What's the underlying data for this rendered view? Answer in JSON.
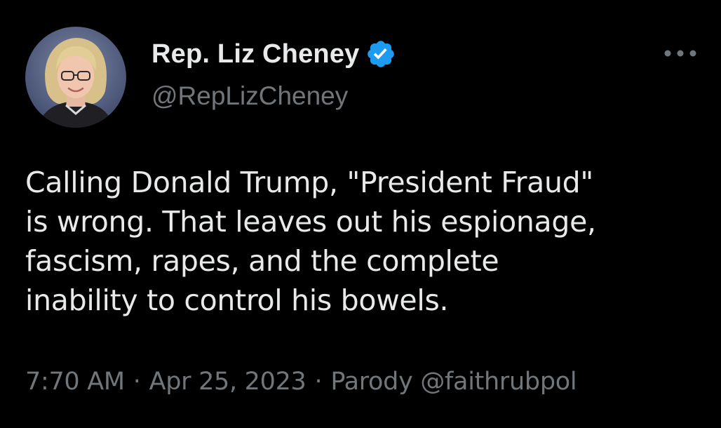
{
  "tweet": {
    "author": {
      "display_name": "Rep. Liz Cheney",
      "handle": "@RepLizCheney",
      "verified": true,
      "avatar_icon": "profile-photo"
    },
    "text_lines": [
      "Calling Donald Trump, \"President Fraud\"",
      "is wrong. That leaves out his espionage,",
      "fascism, rapes, and the complete",
      "inability to control his bowels."
    ],
    "meta": {
      "time": "7:70 AM",
      "separator": "·",
      "date": "Apr 25, 2023",
      "source": "Parody @faithrubpol"
    },
    "more_icon": "more-horizontal-icon"
  },
  "colors": {
    "background": "#000000",
    "primary_text": "#e7e9ea",
    "secondary_text": "#71767b",
    "verified_blue": "#1d9bf0"
  }
}
